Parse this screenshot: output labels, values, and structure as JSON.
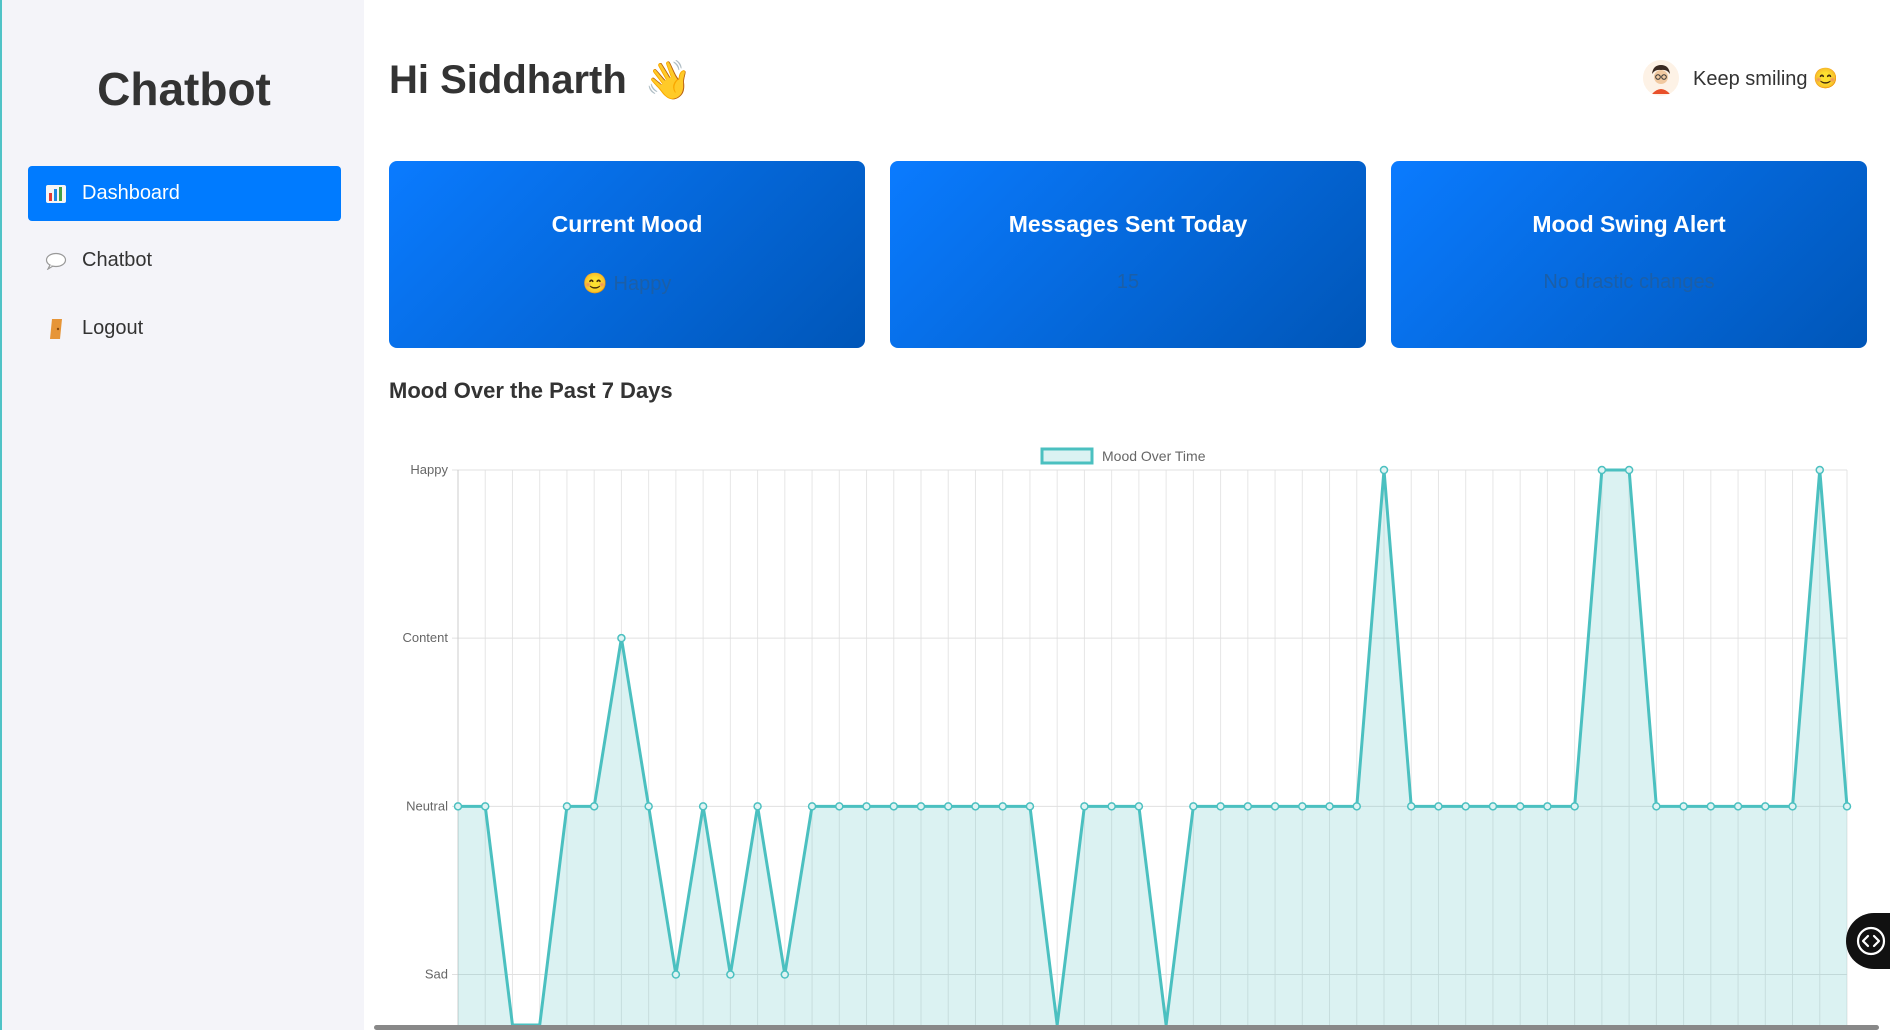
{
  "sidebar": {
    "brand": "Chatbot",
    "items": [
      {
        "label": "Dashboard",
        "icon": "chart-icon",
        "active": true
      },
      {
        "label": "Chatbot",
        "icon": "speech-bubble-icon",
        "active": false
      },
      {
        "label": "Logout",
        "icon": "door-icon",
        "active": false
      }
    ]
  },
  "header": {
    "greeting": "Hi Siddharth",
    "wave": "👋",
    "tagline": "Keep smiling 😊",
    "avatar_icon": "avatar-icon"
  },
  "cards": [
    {
      "title": "Current Mood",
      "emoji": "😊",
      "value": "Happy"
    },
    {
      "title": "Messages Sent Today",
      "emoji": "",
      "value": "15"
    },
    {
      "title": "Mood Swing Alert",
      "emoji": "",
      "value": "No drastic changes"
    }
  ],
  "chart_section_title": "Mood Over the Past 7 Days",
  "colors": {
    "primary": "#007bff",
    "line": "#4bc0c0",
    "fill": "rgba(75,192,192,0.2)"
  },
  "chart_data": {
    "type": "area",
    "legend": "Mood Over Time",
    "legend_position": "top",
    "y_categories": [
      "Sad",
      "Neutral",
      "Content",
      "Happy"
    ],
    "ylim": [
      -0.3,
      3
    ],
    "grid": true,
    "series": [
      {
        "name": "Mood Over Time",
        "values": [
          1,
          1,
          -0.3,
          -0.3,
          1,
          1,
          2,
          1,
          0,
          1,
          0,
          1,
          0,
          1,
          1,
          1,
          1,
          1,
          1,
          1,
          1,
          1,
          -0.3,
          1,
          1,
          1,
          -0.3,
          1,
          1,
          1,
          1,
          1,
          1,
          1,
          3,
          1,
          1,
          1,
          1,
          1,
          1,
          1,
          3,
          3,
          1,
          1,
          1,
          1,
          1,
          1,
          3,
          1
        ]
      }
    ]
  }
}
